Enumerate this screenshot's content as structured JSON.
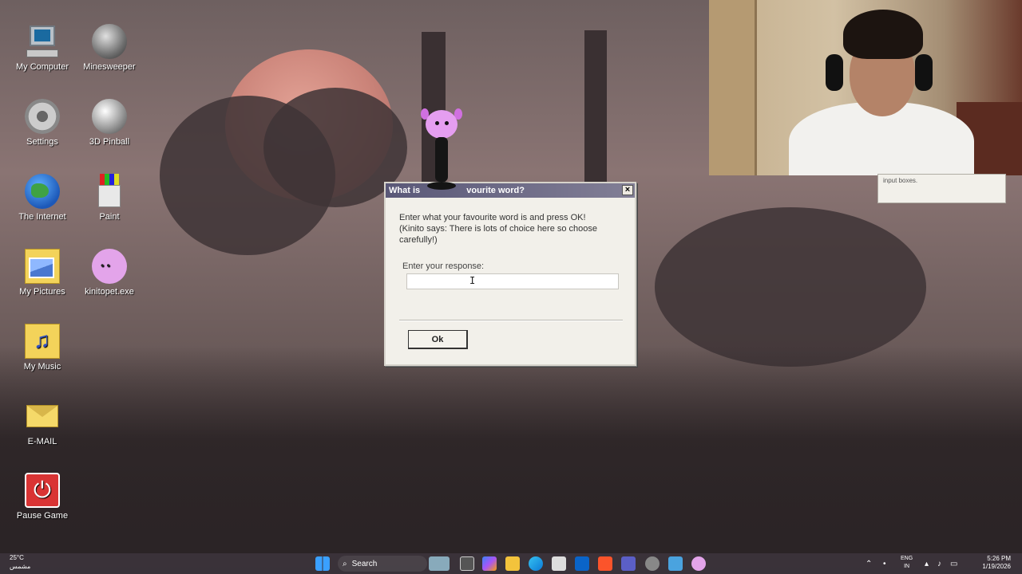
{
  "desktop": {
    "icons": [
      {
        "label": "My Computer",
        "icon": "computer-icon"
      },
      {
        "label": "Minesweeper",
        "icon": "minesweeper-icon"
      },
      {
        "label": "Settings",
        "icon": "gear-icon"
      },
      {
        "label": "3D Pinball",
        "icon": "pinball-icon"
      },
      {
        "label": "The Internet",
        "icon": "globe-icon"
      },
      {
        "label": "Paint",
        "icon": "paint-icon"
      },
      {
        "label": "My Pictures",
        "icon": "pictures-folder-icon"
      },
      {
        "label": "kinitopet.exe",
        "icon": "axolotl-icon"
      },
      {
        "label": "My Music",
        "icon": "music-folder-icon"
      },
      {
        "label": "E-MAIL",
        "icon": "envelope-icon"
      },
      {
        "label": "Pause Game",
        "icon": "power-icon"
      }
    ]
  },
  "dialog": {
    "title": "What is your favourite word?",
    "title_visible_start": "What is",
    "title_visible_end": "vourite word?",
    "close_label": "×",
    "message_line1": "Enter what your favourite word is and press OK!",
    "message_line2": "(Kinito says: There is lots of choice here so choose carefully!)",
    "response_label": "Enter your response:",
    "response_value": "",
    "ok_label": "Ok"
  },
  "background_window": {
    "text": "input boxes."
  },
  "taskbar": {
    "weather_temp": "25°C",
    "weather_desc": "مشمس",
    "search_label": "Search",
    "lang_top": "ENG",
    "lang_bottom": "IN",
    "time": "5:26 PM",
    "date": "1/19/2026",
    "pinned": [
      "windows-start-icon",
      "search-icon",
      "widgets-icon",
      "task-view-icon",
      "copilot-icon",
      "file-explorer-icon",
      "edge-icon",
      "store-icon",
      "outlook-icon",
      "brave-icon",
      "teams-icon",
      "settings-icon",
      "app-icon",
      "kinito-icon"
    ]
  },
  "colors": {
    "dialog_title_bar": "#5a5878",
    "dialog_bg": "#f2f0ea",
    "moon": "#cf857a"
  }
}
